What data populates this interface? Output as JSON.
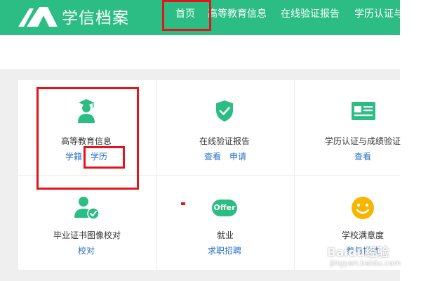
{
  "header": {
    "site_title": "学信档案",
    "nav": [
      "首页",
      "高等教育信息",
      "在线验证报告",
      "学历认证与"
    ]
  },
  "tiles": [
    {
      "title": "高等教育信息",
      "icon": "graduate-user-icon",
      "links": [
        "学籍",
        "学历"
      ]
    },
    {
      "title": "在线验证报告",
      "icon": "shield-check-icon",
      "links": [
        "查看",
        "申请"
      ]
    },
    {
      "title": "学历认证与成绩验证",
      "icon": "id-card-icon",
      "links": [
        "查看"
      ]
    },
    {
      "title": "毕业证书图像校对",
      "icon": "user-check-icon",
      "links": [
        "校对"
      ]
    },
    {
      "title": "就业",
      "icon": "offer-badge-icon",
      "badge": "Offer",
      "links": [
        "求职招聘"
      ]
    },
    {
      "title": "学校满意度",
      "icon": "smiley-icon",
      "links": [
        "参与投票"
      ]
    }
  ],
  "watermark": {
    "brand": "Baidu经验",
    "url": "jingyan.baidu.com"
  },
  "colors": {
    "brand_green": "#2bbd84",
    "link_blue": "#2a72c8",
    "highlight_red": "#e3151c",
    "smiley_yellow": "#f7b500"
  }
}
